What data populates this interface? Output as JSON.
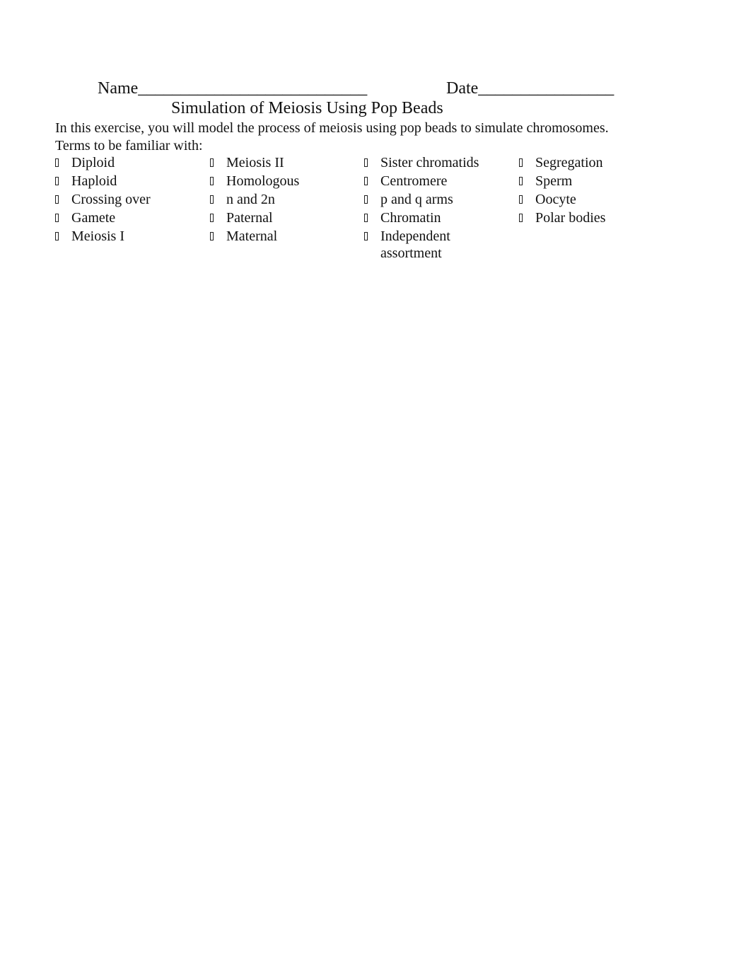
{
  "header": {
    "name_label": "Name___________________________",
    "date_label": "Date________________"
  },
  "title": "Simulation of Meiosis Using Pop Beads",
  "intro": "In this exercise, you will model the process of meiosis using pop beads to simulate chromosomes.",
  "terms_heading": "Terms to be familiar with:",
  "bullet_icon": "missing-glyph-box",
  "term_columns": [
    [
      "Diploid",
      "Haploid",
      "Crossing over",
      "Gamete",
      "Meiosis I"
    ],
    [
      "Meiosis II",
      "Homologous",
      "n and 2n",
      "Paternal",
      "Maternal"
    ],
    [
      "Sister chromatids",
      "Centromere",
      "p and q arms",
      "Chromatin",
      "Independent assortment"
    ],
    [
      "Segregation",
      "Sperm",
      "Oocyte",
      "Polar bodies"
    ]
  ]
}
